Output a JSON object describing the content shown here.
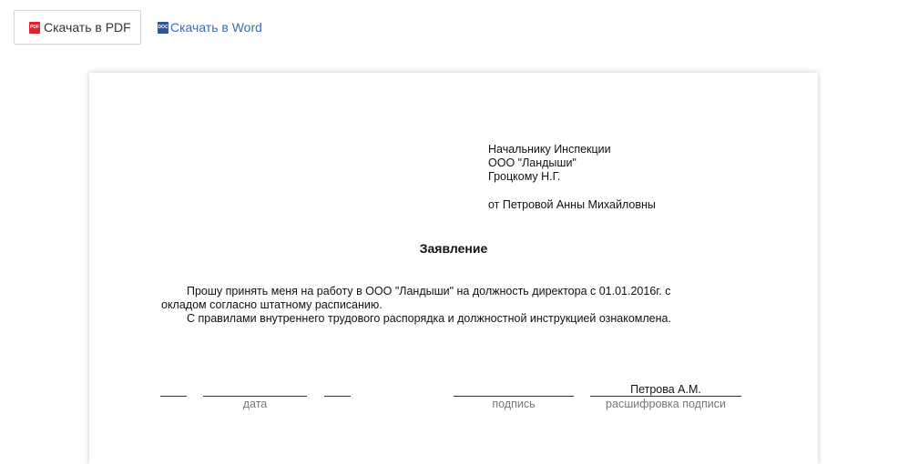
{
  "toolbar": {
    "pdf_icon_text": "PDF",
    "pdf_label": "Скачать в PDF",
    "word_icon_text": "DOC",
    "word_label": "Скачать в Word"
  },
  "document": {
    "addressee": {
      "line1": "Начальнику Инспекции",
      "line2": "ООО \"Ландыши\"",
      "line3": "Гроцкому Н.Г.",
      "from": "от Петровой Анны Михайловны"
    },
    "title": "Заявление",
    "paragraph1_indent": "Прошу принять меня на работу в ООО \"Ландыши\" на должность директора с 01.01.2016г. с",
    "paragraph1_cont": "окладом согласно штатному расписанию.",
    "paragraph2": "С правилами внутреннего трудового распорядка и должностной инструкцией ознакомлена.",
    "signature": {
      "date_caption": "дата",
      "signature_caption": "подпись",
      "name": "Петрова А.М.",
      "name_caption": "расшифровка подписи"
    }
  }
}
